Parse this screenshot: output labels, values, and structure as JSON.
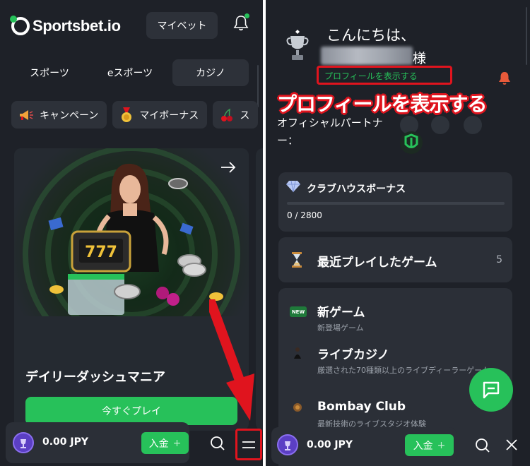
{
  "left": {
    "logo": {
      "text": "Sportsbet.io"
    },
    "mybet_label": "マイベット",
    "tabs": [
      {
        "label": "スポーツ",
        "active": false
      },
      {
        "label": "eスポーツ",
        "active": false
      },
      {
        "label": "カジノ",
        "active": true
      }
    ],
    "chips": [
      {
        "label": "キャンペーン",
        "icon": "megaphone-icon"
      },
      {
        "label": "マイボーナス",
        "icon": "medal-icon"
      },
      {
        "label": "ス",
        "icon": "cherries-icon"
      }
    ],
    "promo": {
      "title": "デイリーダッシュマニア",
      "button": "今すぐプレイ",
      "reels": "777"
    },
    "wallet": {
      "amount": "0.00 JPY",
      "deposit": "入金",
      "deposit_plus": "+"
    }
  },
  "right": {
    "greeting": "こんにちは、",
    "honorific": "様",
    "profile_link": "プロフィールを表示する",
    "annotation": "プロフィールを表示する",
    "partner_text": "オフィシャルパートナー：",
    "club": {
      "title": "クラブハウスボーナス",
      "progress": "0 / 2800",
      "value": 0,
      "max": 2800
    },
    "recent": {
      "title": "最近プレイしたゲーム",
      "count": "5"
    },
    "list": [
      {
        "title": "新ゲーム",
        "sub": "新登場ゲーム",
        "icon": "new-badge-icon",
        "badge": "NEW"
      },
      {
        "title": "ライブカジノ",
        "sub": "厳選された70種類以上のライブディーラーゲーム",
        "icon": "live-casino-icon"
      },
      {
        "title": "Bombay Club",
        "sub": "最新技術のライブスタジオ体験",
        "icon": "bombay-club-icon"
      }
    ],
    "wallet": {
      "amount": "0.00 JPY",
      "deposit": "入金",
      "deposit_plus": "+"
    }
  },
  "colors": {
    "background": "#1e2128",
    "card": "#2b2f37",
    "accent_green": "#27c15a",
    "highlight_red": "#e0141e",
    "wallet_purple": "#5b3fc4"
  }
}
